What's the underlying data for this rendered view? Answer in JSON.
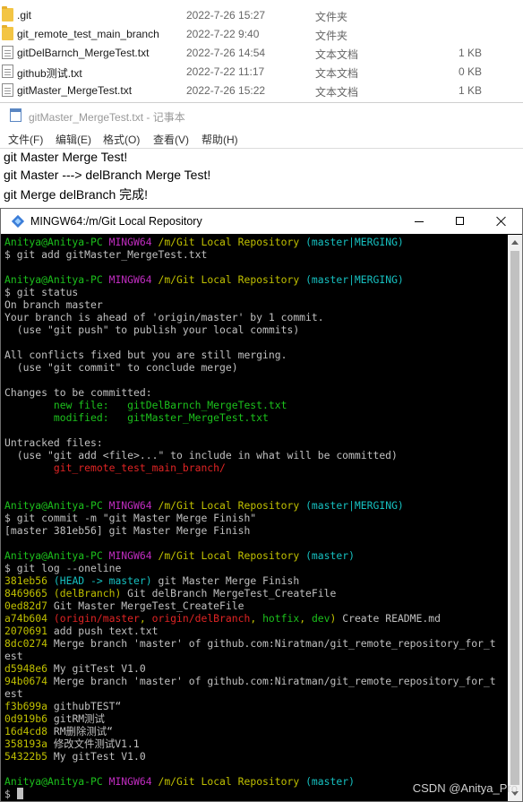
{
  "explorer": {
    "files": [
      {
        "icon": "folder-icon",
        "name": ".git",
        "date": "2022-7-26 15:27",
        "type": "文件夹",
        "size": ""
      },
      {
        "icon": "folder-icon",
        "name": "git_remote_test_main_branch",
        "date": "2022-7-22 9:40",
        "type": "文件夹",
        "size": ""
      },
      {
        "icon": "text-file-icon",
        "name": "gitDelBarnch_MergeTest.txt",
        "date": "2022-7-26 14:54",
        "type": "文本文档",
        "size": "1 KB"
      },
      {
        "icon": "text-file-icon",
        "name": "github测试.txt",
        "date": "2022-7-22 11:17",
        "type": "文本文档",
        "size": "0 KB"
      },
      {
        "icon": "text-file-icon",
        "name": "gitMaster_MergeTest.txt",
        "date": "2022-7-26 15:22",
        "type": "文本文档",
        "size": "1 KB"
      }
    ]
  },
  "notepad": {
    "title": "gitMaster_MergeTest.txt - 记事本",
    "menu": [
      "文件(F)",
      "编辑(E)",
      "格式(O)",
      "查看(V)",
      "帮助(H)"
    ],
    "lines": [
      "git Master Merge Test!",
      "git Master ---> delBranch Merge Test!",
      "git Merge delBranch 完成!"
    ]
  },
  "terminal": {
    "title": "MINGW64:/m/Git Local Repository",
    "colors": {
      "green": "#1cc11c",
      "purple": "#bf2cbf",
      "yellow": "#c0c000",
      "cyan": "#16c0c0",
      "red": "#e02424",
      "default": "#c0c0c0",
      "background": "#000000"
    },
    "lines": [
      [
        [
          "green",
          "Anitya@Anitya-PC "
        ],
        [
          "purple",
          "MINGW64 "
        ],
        [
          "yellow",
          "/m/Git Local Repository "
        ],
        [
          "cyan",
          "(master|MERGING)"
        ]
      ],
      [
        [
          "grey",
          "$ git add gitMaster_MergeTest.txt"
        ]
      ],
      [],
      [
        [
          "green",
          "Anitya@Anitya-PC "
        ],
        [
          "purple",
          "MINGW64 "
        ],
        [
          "yellow",
          "/m/Git Local Repository "
        ],
        [
          "cyan",
          "(master|MERGING)"
        ]
      ],
      [
        [
          "grey",
          "$ git status"
        ]
      ],
      [
        [
          "grey",
          "On branch master"
        ]
      ],
      [
        [
          "grey",
          "Your branch is ahead of 'origin/master' by 1 commit."
        ]
      ],
      [
        [
          "grey",
          "  (use \"git push\" to publish your local commits)"
        ]
      ],
      [],
      [
        [
          "grey",
          "All conflicts fixed but you are still merging."
        ]
      ],
      [
        [
          "grey",
          "  (use \"git commit\" to conclude merge)"
        ]
      ],
      [],
      [
        [
          "grey",
          "Changes to be committed:"
        ]
      ],
      [
        [
          "green",
          "        new file:   gitDelBarnch_MergeTest.txt"
        ]
      ],
      [
        [
          "green",
          "        modified:   gitMaster_MergeTest.txt"
        ]
      ],
      [],
      [
        [
          "grey",
          "Untracked files:"
        ]
      ],
      [
        [
          "grey",
          "  (use \"git add <file>...\" to include in what will be committed)"
        ]
      ],
      [
        [
          "red",
          "        git_remote_test_main_branch/"
        ]
      ],
      [],
      [],
      [
        [
          "green",
          "Anitya@Anitya-PC "
        ],
        [
          "purple",
          "MINGW64 "
        ],
        [
          "yellow",
          "/m/Git Local Repository "
        ],
        [
          "cyan",
          "(master|MERGING)"
        ]
      ],
      [
        [
          "grey",
          "$ git commit -m \"git Master Merge Finish\""
        ]
      ],
      [
        [
          "grey",
          "[master 381eb56] git Master Merge Finish"
        ]
      ],
      [],
      [
        [
          "green",
          "Anitya@Anitya-PC "
        ],
        [
          "purple",
          "MINGW64 "
        ],
        [
          "yellow",
          "/m/Git Local Repository "
        ],
        [
          "cyan",
          "(master)"
        ]
      ],
      [
        [
          "grey",
          "$ git log --oneline"
        ]
      ],
      [
        [
          "yellow",
          "381eb56 "
        ],
        [
          "cyan",
          "(HEAD -> master)"
        ],
        [
          "grey",
          " git Master Merge Finish"
        ]
      ],
      [
        [
          "yellow",
          "8469665 "
        ],
        [
          "yellow",
          "(delBranch)"
        ],
        [
          "grey",
          " Git delBranch MergeTest_CreateFile"
        ]
      ],
      [
        [
          "yellow",
          "0ed82d7 "
        ],
        [
          "grey",
          "Git Master MergeTest_CreateFile"
        ]
      ],
      [
        [
          "yellow",
          "a74b604 "
        ],
        [
          "red",
          "(origin/master"
        ],
        [
          "yellow",
          ", "
        ],
        [
          "red",
          "origin/delBranch"
        ],
        [
          "yellow",
          ", "
        ],
        [
          "green",
          "hotfix"
        ],
        [
          "yellow",
          ", "
        ],
        [
          "green",
          "dev"
        ],
        [
          "yellow",
          ")"
        ],
        [
          "grey",
          " Create README.md"
        ]
      ],
      [
        [
          "yellow",
          "2070691 "
        ],
        [
          "grey",
          "add push text.txt"
        ]
      ],
      [
        [
          "yellow",
          "8dc0274 "
        ],
        [
          "grey",
          "Merge branch 'master' of github.com:Niratman/git_remote_repository_for_t"
        ]
      ],
      [
        [
          "grey",
          "est"
        ]
      ],
      [
        [
          "yellow",
          "d5948e6 "
        ],
        [
          "grey",
          "My gitTest V1.0"
        ]
      ],
      [
        [
          "yellow",
          "94b0674 "
        ],
        [
          "grey",
          "Merge branch 'master' of github.com:Niratman/git_remote_repository_for_t"
        ]
      ],
      [
        [
          "grey",
          "est"
        ]
      ],
      [
        [
          "yellow",
          "f3b699a "
        ],
        [
          "grey",
          "githubTEST“"
        ]
      ],
      [
        [
          "yellow",
          "0d919b6 "
        ],
        [
          "grey",
          "gitRM测试"
        ]
      ],
      [
        [
          "yellow",
          "16d4cd8 "
        ],
        [
          "grey",
          "RM删除测试“"
        ]
      ],
      [
        [
          "yellow",
          "358193a "
        ],
        [
          "grey",
          "修改文件测试V1.1"
        ]
      ],
      [
        [
          "yellow",
          "54322b5 "
        ],
        [
          "grey",
          "My gitTest V1.0"
        ]
      ],
      [],
      [
        [
          "green",
          "Anitya@Anitya-PC "
        ],
        [
          "purple",
          "MINGW64 "
        ],
        [
          "yellow",
          "/m/Git Local Repository "
        ],
        [
          "cyan",
          "(master)"
        ]
      ],
      [
        [
          "grey",
          "$ "
        ]
      ]
    ]
  },
  "watermark": "CSDN @Anitya_Pro"
}
